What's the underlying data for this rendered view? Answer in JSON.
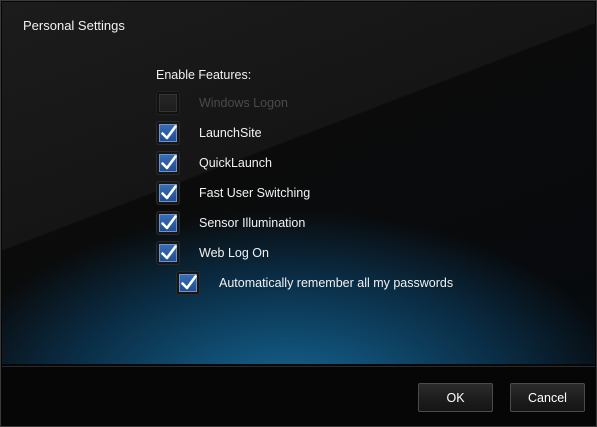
{
  "window": {
    "title": "Personal Settings"
  },
  "features": {
    "label": "Enable Features:",
    "options": [
      {
        "label": "Windows Logon",
        "checked": false,
        "enabled": false
      },
      {
        "label": "LaunchSite",
        "checked": true,
        "enabled": true
      },
      {
        "label": "QuickLaunch",
        "checked": true,
        "enabled": true
      },
      {
        "label": "Fast User Switching",
        "checked": true,
        "enabled": true
      },
      {
        "label": "Sensor Illumination",
        "checked": true,
        "enabled": true
      },
      {
        "label": "Web Log On",
        "checked": true,
        "enabled": true
      },
      {
        "label": "Automatically remember all my passwords",
        "checked": true,
        "enabled": true
      }
    ]
  },
  "buttons": {
    "ok_label": "OK",
    "cancel_label": "Cancel"
  },
  "colors": {
    "check_fill": "#2a5aa2",
    "check_mark": "#ffffff",
    "accent_glow": "#1a6c9b"
  }
}
